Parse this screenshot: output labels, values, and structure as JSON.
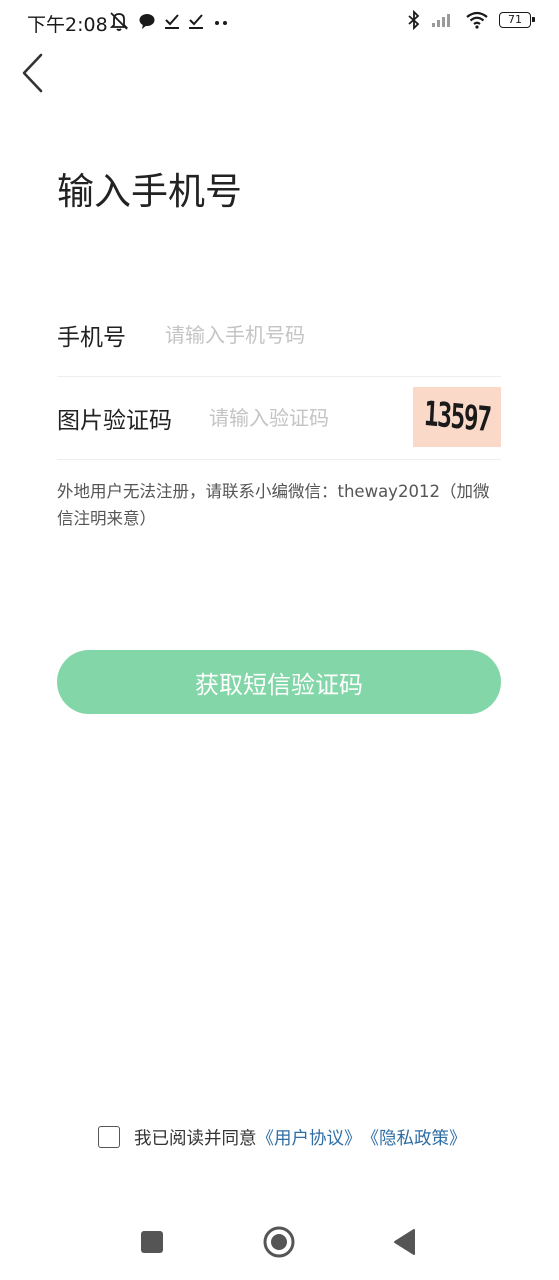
{
  "status_bar": {
    "time": "下午2:08",
    "battery_level": "71",
    "left_icons": [
      "alarm-off-icon",
      "chat-bubble-icon",
      "check-icon",
      "check-icon",
      "more-dots-icon"
    ],
    "right_icons": [
      "bluetooth-icon",
      "signal-icon",
      "wifi-icon",
      "battery-icon"
    ]
  },
  "header": {
    "back_icon": "chevron-left-icon"
  },
  "page": {
    "title": "输入手机号"
  },
  "form": {
    "phone": {
      "label": "手机号",
      "placeholder": "请输入手机号码",
      "value": ""
    },
    "captcha": {
      "label": "图片验证码",
      "placeholder": "请输入验证码",
      "value": "",
      "image_text": "13597",
      "image_background": "#fbd9c9"
    },
    "notice": "外地用户无法注册，请联系小编微信：theway2012（加微信注明来意）"
  },
  "submit": {
    "label": "获取短信验证码",
    "background": "#83d6a8"
  },
  "agreement": {
    "checked": false,
    "text": "我已阅读并同意",
    "user_agreement": "《用户协议》",
    "privacy_policy": "《隐私政策》",
    "link_color": "#2f6ea5"
  },
  "nav_bar": {
    "icons": [
      "recent-apps-icon",
      "home-icon",
      "back-triangle-icon"
    ]
  }
}
